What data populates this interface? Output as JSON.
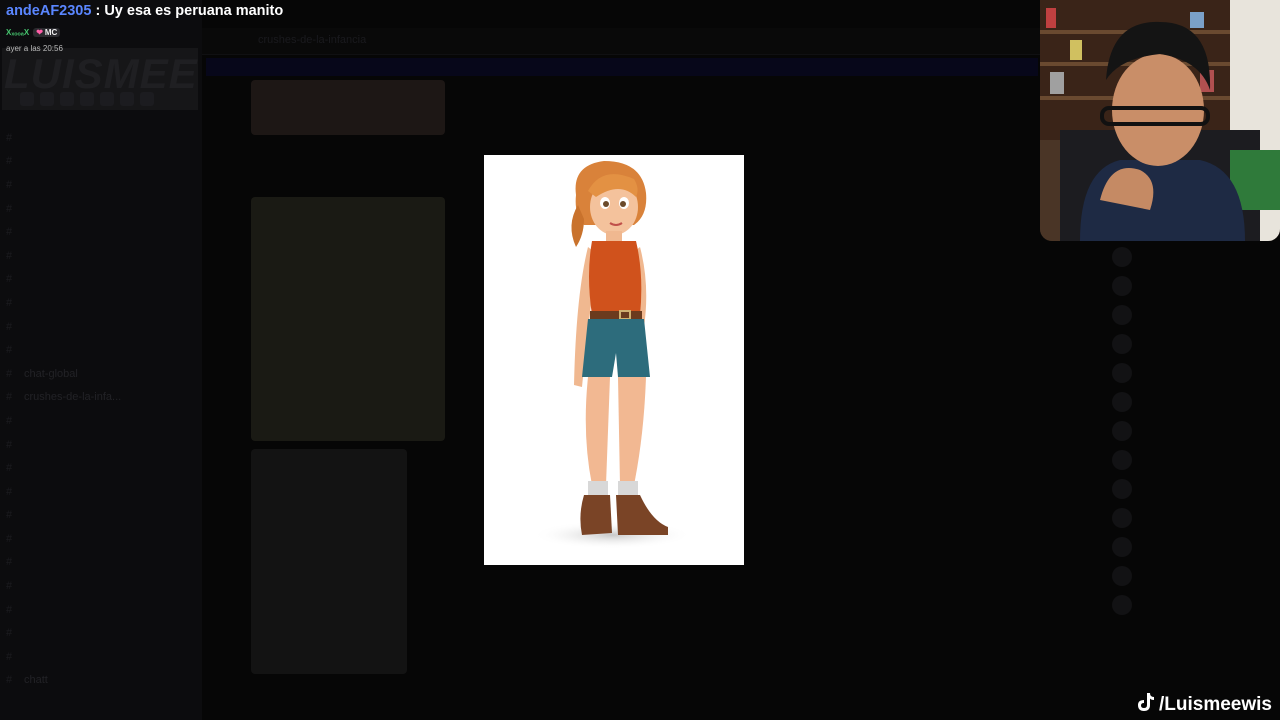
{
  "chat": {
    "username": "andeAF2305",
    "separator": " : ",
    "message": "Uy esa es peruana manito",
    "badge_sub": "XₓₒₒₐX",
    "badge_mc": "MC",
    "timestamp": "ayer a las 20:56"
  },
  "background_app": {
    "server_name": "LUISMEEWIS",
    "channel_name": "crushes-de-la-infancia",
    "channels": [
      "",
      "",
      "",
      "",
      "",
      "",
      "",
      "",
      "",
      "",
      "chat-global",
      "crushes-de-la-infa...",
      "",
      "",
      "",
      "",
      "",
      "",
      "",
      "",
      "",
      "",
      "",
      "chatt"
    ]
  },
  "overlay": {
    "tiktok_handle": "/Luismeewis"
  },
  "colors": {
    "username": "#5a86ff",
    "background": "#060606"
  }
}
